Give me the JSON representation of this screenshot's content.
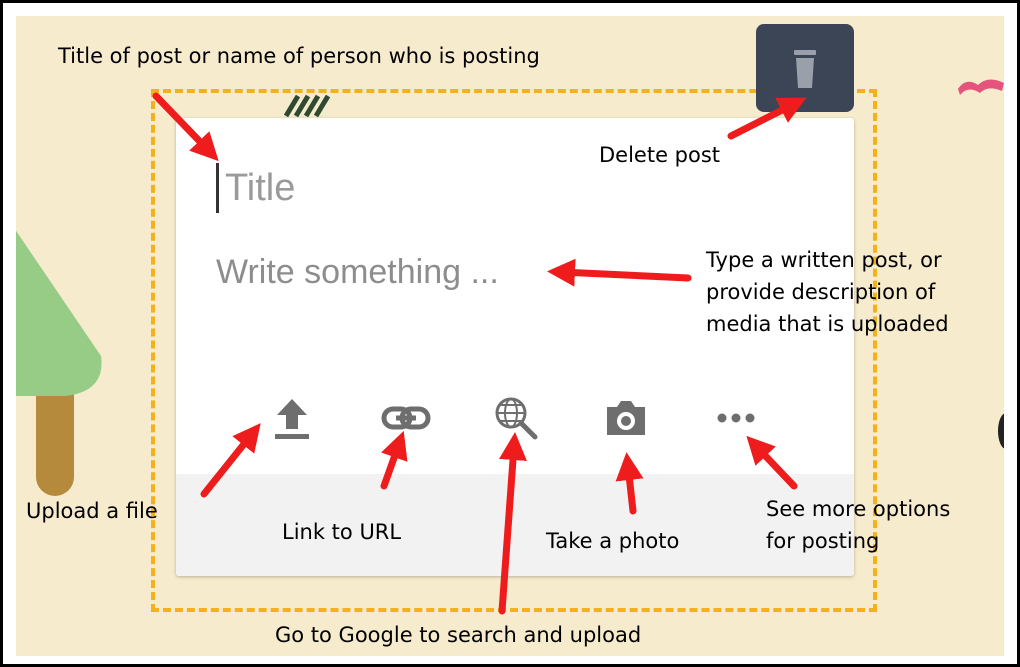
{
  "card": {
    "title_placeholder": "Title",
    "body_placeholder": "Write something ...",
    "delete_icon": "trash-icon",
    "toolbar_icons": [
      "upload-icon",
      "link-icon",
      "globe-search-icon",
      "camera-icon",
      "more-horizontal-icon"
    ]
  },
  "annotations": {
    "title": "Title of post or name of person who is posting",
    "delete": "Delete post",
    "write": [
      "Type a written post, or",
      "provide description of",
      "media that is uploaded"
    ],
    "upload": "Upload a file",
    "link": "Link to URL",
    "photo": "Take a photo",
    "more": [
      "See more options",
      "for posting"
    ],
    "google": "Go to Google to search and upload"
  },
  "colors": {
    "background": "#f6ebcc",
    "dashed_border": "#f3b21c",
    "arrow": "#ee1c1c",
    "delete_button": "#3b4556",
    "icon_gray": "#6e6e6e"
  }
}
